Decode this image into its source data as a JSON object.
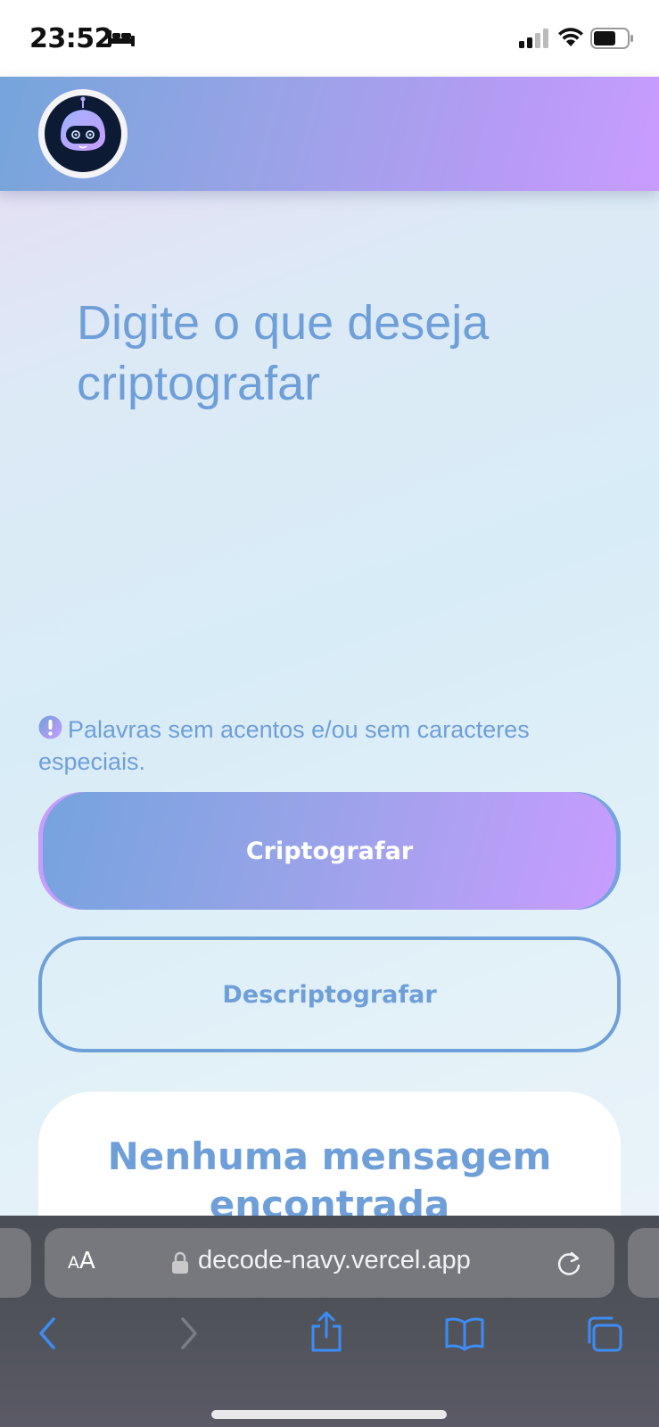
{
  "status_bar": {
    "time": "23:52"
  },
  "main": {
    "input_placeholder": "Digite o que deseja criptografar",
    "warning_text": "Palavras sem acentos e/ou sem caracteres especiais.",
    "encrypt_label": "Criptografar",
    "decrypt_label": "Descriptografar",
    "result_title": "Nenhuma mensagem encontrada"
  },
  "browser": {
    "aa_label_small": "A",
    "aa_label_large": "A",
    "url": "decode-navy.vercel.app"
  },
  "colors": {
    "accent": "#6f9fd8",
    "gradient_start": "#75a4db",
    "gradient_end": "#c99cff"
  },
  "icons": {
    "status": [
      "bed-icon",
      "signal-icon",
      "wifi-icon",
      "battery-icon"
    ],
    "browser_toolbar": [
      "back-icon",
      "forward-icon",
      "share-icon",
      "bookmarks-icon",
      "tabs-icon"
    ]
  }
}
